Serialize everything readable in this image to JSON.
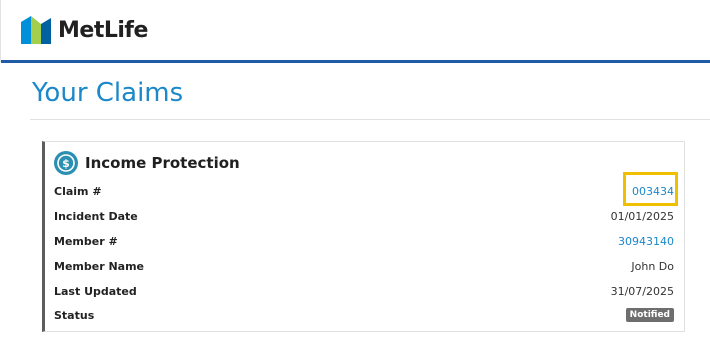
{
  "brand": {
    "name": "MetLife",
    "primary_color": "#1b88c9",
    "rule_color": "#1f5aa6"
  },
  "page": {
    "title": "Your Claims"
  },
  "claim_card": {
    "title": "Income Protection",
    "icon": "dollar-circle-icon",
    "fields": {
      "claim_number": {
        "label": "Claim #",
        "value": "003434"
      },
      "incident_date": {
        "label": "Incident Date",
        "value": "01/01/2025"
      },
      "member_number": {
        "label": "Member #",
        "value": "30943140"
      },
      "member_name": {
        "label": "Member Name",
        "value": "John Do"
      },
      "last_updated": {
        "label": "Last Updated",
        "value": "31/07/2025"
      },
      "status": {
        "label": "Status",
        "value": "Notified"
      }
    },
    "highlight_color": "#f0c000"
  }
}
